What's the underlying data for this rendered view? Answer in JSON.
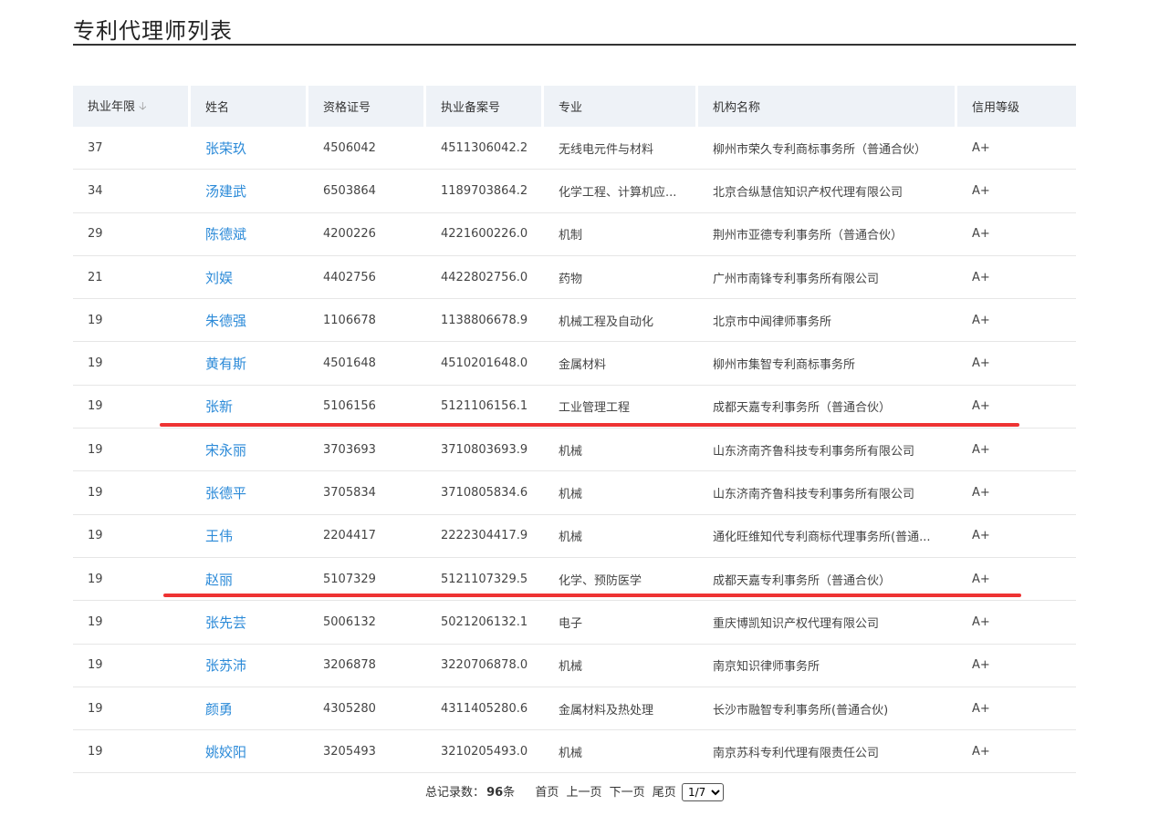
{
  "page": {
    "title": "专利代理师列表"
  },
  "table": {
    "headers": [
      "执业年限",
      "姓名",
      "资格证号",
      "执业备案号",
      "专业",
      "机构名称",
      "信用等级"
    ],
    "sort_icon": "arrow-down-icon",
    "rows": [
      [
        "37",
        "张荣玖",
        "4506042",
        "4511306042.2",
        "无线电元件与材料",
        "柳州市荣久专利商标事务所（普通合伙）",
        "A+"
      ],
      [
        "34",
        "汤建武",
        "6503864",
        "1189703864.2",
        "化学工程、计算机应...",
        "北京合纵慧信知识产权代理有限公司",
        "A+"
      ],
      [
        "29",
        "陈德斌",
        "4200226",
        "4221600226.0",
        "机制",
        "荆州市亚德专利事务所（普通合伙）",
        "A+"
      ],
      [
        "21",
        "刘娱",
        "4402756",
        "4422802756.0",
        "药物",
        "广州市南锋专利事务所有限公司",
        "A+"
      ],
      [
        "19",
        "朱德强",
        "1106678",
        "1138806678.9",
        "机械工程及自动化",
        "北京市中闻律师事务所",
        "A+"
      ],
      [
        "19",
        "黄有斯",
        "4501648",
        "4510201648.0",
        "金属材料",
        "柳州市集智专利商标事务所",
        "A+"
      ],
      [
        "19",
        "张新",
        "5106156",
        "5121106156.1",
        "工业管理工程",
        "成都天嘉专利事务所（普通合伙）",
        "A+"
      ],
      [
        "19",
        "宋永丽",
        "3703693",
        "3710803693.9",
        "机械",
        "山东济南齐鲁科技专利事务所有限公司",
        "A+"
      ],
      [
        "19",
        "张德平",
        "3705834",
        "3710805834.6",
        "机械",
        "山东济南齐鲁科技专利事务所有限公司",
        "A+"
      ],
      [
        "19",
        "王伟",
        "2204417",
        "2222304417.9",
        "机械",
        "通化旺维知代专利商标代理事务所(普通...",
        "A+"
      ],
      [
        "19",
        "赵丽",
        "5107329",
        "5121107329.5",
        "化学、预防医学",
        "成都天嘉专利事务所（普通合伙）",
        "A+"
      ],
      [
        "19",
        "张先芸",
        "5006132",
        "5021206132.1",
        "电子",
        "重庆博凯知识产权代理有限公司",
        "A+"
      ],
      [
        "19",
        "张苏沛",
        "3206878",
        "3220706878.0",
        "机械",
        "南京知识律师事务所",
        "A+"
      ],
      [
        "19",
        "颜勇",
        "4305280",
        "4311405280.6",
        "金属材料及热处理",
        "长沙市融智专利事务所(普通合伙)",
        "A+"
      ],
      [
        "19",
        "姚姣阳",
        "3205493",
        "3210205493.0",
        "机械",
        "南京苏科专利代理有限责任公司",
        "A+"
      ]
    ]
  },
  "pagination": {
    "total_label": "总记录数：",
    "total": "96",
    "unit": "条",
    "first": "首页",
    "prev": "上一页",
    "next": "下一页",
    "last": "尾页",
    "current_page": "1/7"
  },
  "colors": {
    "link": "#2b8ad8",
    "highlight_line": "#ee3333",
    "header_bg": "#eef2f7"
  }
}
